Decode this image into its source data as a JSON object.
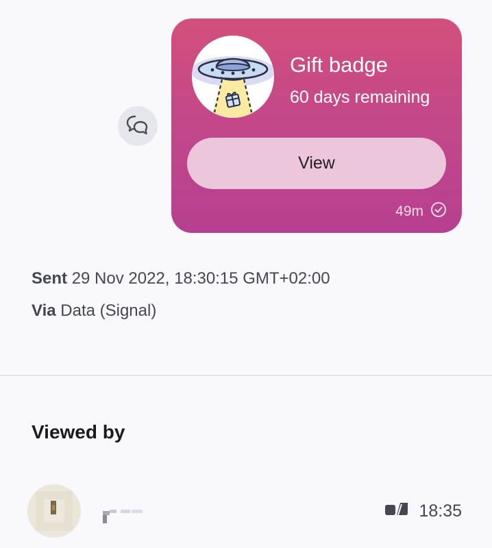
{
  "message": {
    "reply_icon": "reply-bubbles-icon",
    "gift_card": {
      "badge_icon": "ufo-gift-badge-icon",
      "title": "Gift badge",
      "subtitle": "60 days remaining",
      "view_label": "View",
      "time": "49m",
      "status_icon": "sent-check-icon",
      "background_top": "#d2507c",
      "background_bottom": "#b6408f"
    }
  },
  "details": {
    "sent_label": "Sent",
    "sent_value": "29 Nov 2022, 18:30:15 GMT+02:00",
    "via_label": "Via",
    "via_value": "Data (Signal)"
  },
  "viewed_by": {
    "heading": "Viewed by",
    "viewers": [
      {
        "avatar": "pixelated-avatar",
        "status_icon": "viewed-icon",
        "time": "18:35"
      }
    ]
  }
}
